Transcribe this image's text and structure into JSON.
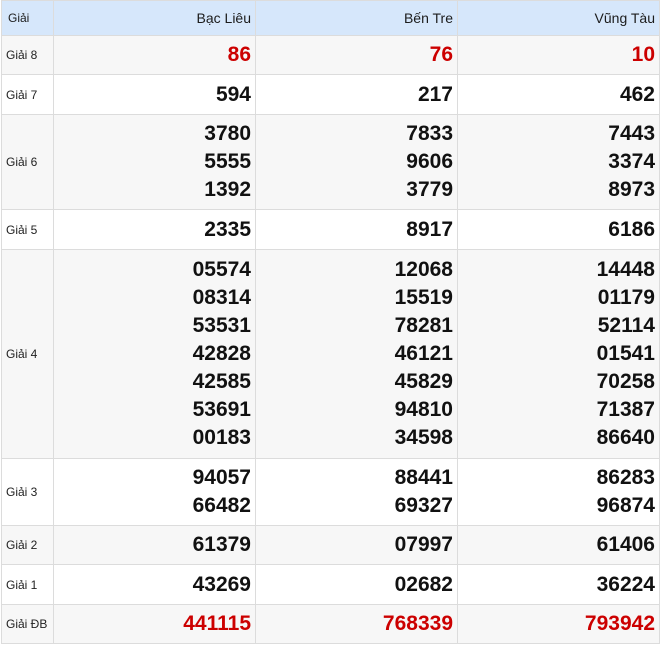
{
  "header": {
    "label": "Giải",
    "provinces": [
      "Bạc Liêu",
      "Bến Tre",
      "Vũng Tàu"
    ]
  },
  "rows": [
    {
      "label": "Giải 8",
      "red": true,
      "values": [
        [
          "86"
        ],
        [
          "76"
        ],
        [
          "10"
        ]
      ]
    },
    {
      "label": "Giải 7",
      "red": false,
      "values": [
        [
          "594"
        ],
        [
          "217"
        ],
        [
          "462"
        ]
      ]
    },
    {
      "label": "Giải 6",
      "red": false,
      "values": [
        [
          "3780",
          "5555",
          "1392"
        ],
        [
          "7833",
          "9606",
          "3779"
        ],
        [
          "7443",
          "3374",
          "8973"
        ]
      ]
    },
    {
      "label": "Giải 5",
      "red": false,
      "values": [
        [
          "2335"
        ],
        [
          "8917"
        ],
        [
          "6186"
        ]
      ]
    },
    {
      "label": "Giải 4",
      "red": false,
      "values": [
        [
          "05574",
          "08314",
          "53531",
          "42828",
          "42585",
          "53691",
          "00183"
        ],
        [
          "12068",
          "15519",
          "78281",
          "46121",
          "45829",
          "94810",
          "34598"
        ],
        [
          "14448",
          "01179",
          "52114",
          "01541",
          "70258",
          "71387",
          "86640"
        ]
      ]
    },
    {
      "label": "Giải 3",
      "red": false,
      "values": [
        [
          "94057",
          "66482"
        ],
        [
          "88441",
          "69327"
        ],
        [
          "86283",
          "96874"
        ]
      ]
    },
    {
      "label": "Giải 2",
      "red": false,
      "values": [
        [
          "61379"
        ],
        [
          "07997"
        ],
        [
          "61406"
        ]
      ]
    },
    {
      "label": "Giải 1",
      "red": false,
      "values": [
        [
          "43269"
        ],
        [
          "02682"
        ],
        [
          "36224"
        ]
      ]
    },
    {
      "label": "Giải ĐB",
      "red": true,
      "values": [
        [
          "441115"
        ],
        [
          "768339"
        ],
        [
          "793942"
        ]
      ]
    }
  ],
  "colors": {
    "header_bg": "#d6e7fb",
    "highlight": "#cc0000",
    "alt_row_bg": "#f7f7f7"
  }
}
